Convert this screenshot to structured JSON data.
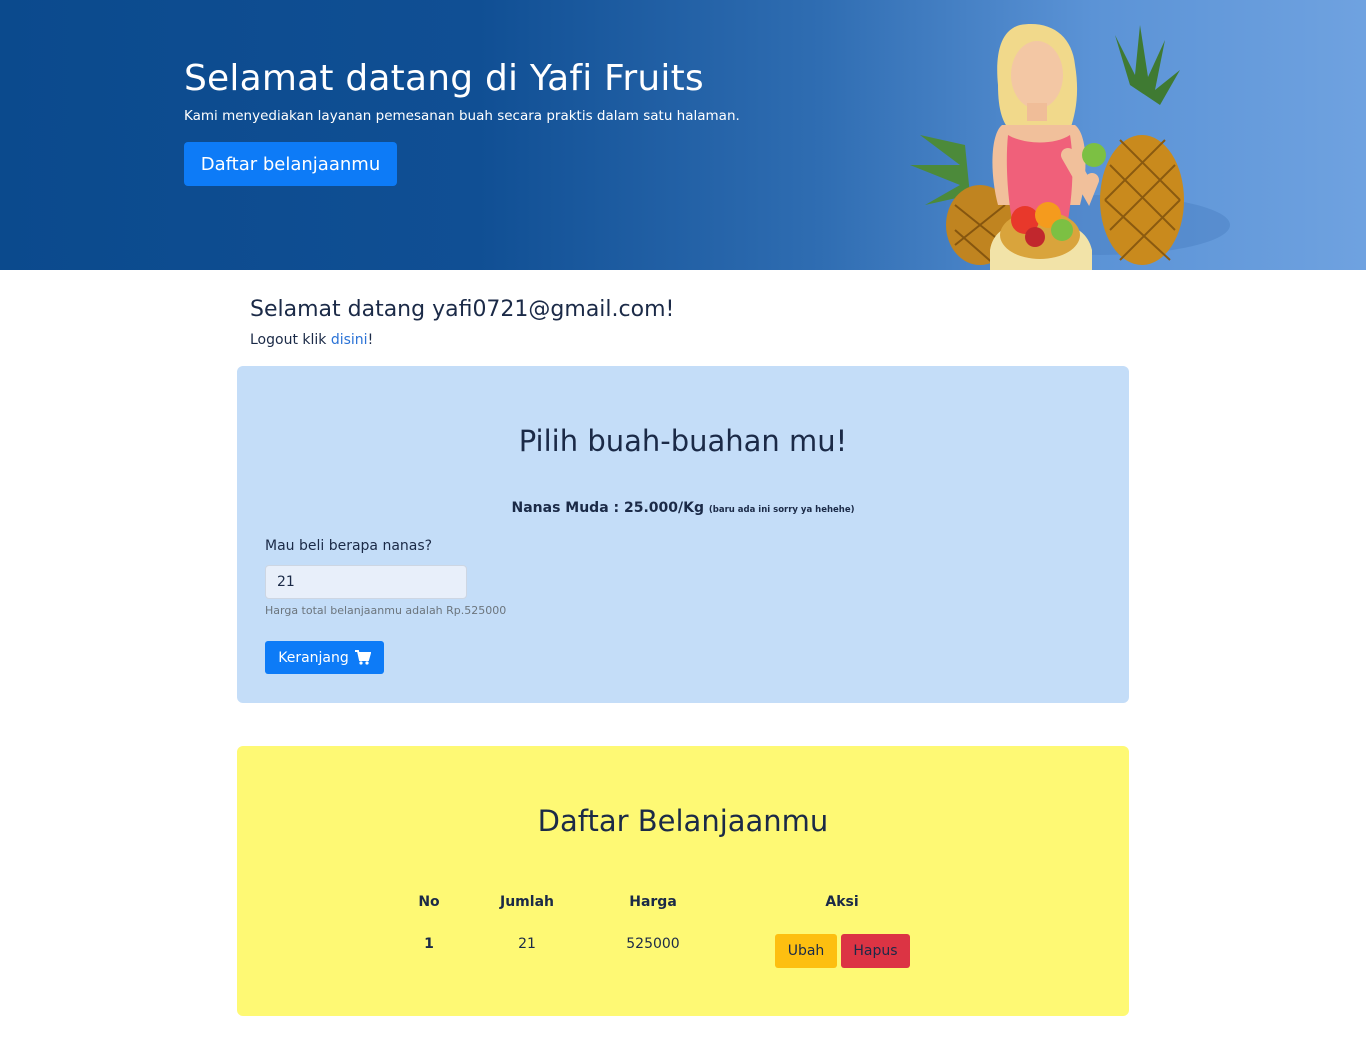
{
  "hero": {
    "title": "Selamat datang di Yafi Fruits",
    "subtitle": "Kami menyediakan layanan pemesanan buah secara praktis dalam satu halaman.",
    "button_label": "Daftar belanjaanmu"
  },
  "user": {
    "welcome": "Selamat datang yafi0721@gmail.com!",
    "logout_prefix": "Logout klik ",
    "logout_link": "disini",
    "logout_suffix": "!"
  },
  "order": {
    "title": "Pilih buah-buahan mu!",
    "product_price": "Nanas Muda : 25.000/Kg",
    "product_note": "(baru ada ini sorry ya hehehe)",
    "quantity_label": "Mau beli berapa nanas?",
    "quantity_value": "21",
    "total_help": "Harga total belanjaanmu adalah Rp.525000",
    "cart_button_label": "Keranjang",
    "cart_icon": "cart-icon"
  },
  "list": {
    "title": "Daftar Belanjaanmu",
    "columns": [
      "No",
      "Jumlah",
      "Harga",
      "Aksi"
    ],
    "rows": [
      {
        "no": "1",
        "jumlah": "21",
        "harga": "525000",
        "edit_label": "Ubah",
        "delete_label": "Hapus"
      }
    ]
  },
  "colors": {
    "hero_dark": "#0b4a8d",
    "hero_light": "#6fa2e0",
    "primary": "#0d7bf7",
    "order_card": "#c4ddf8",
    "list_card": "#fef974",
    "warning": "#fdbf10",
    "danger": "#dc3444"
  }
}
